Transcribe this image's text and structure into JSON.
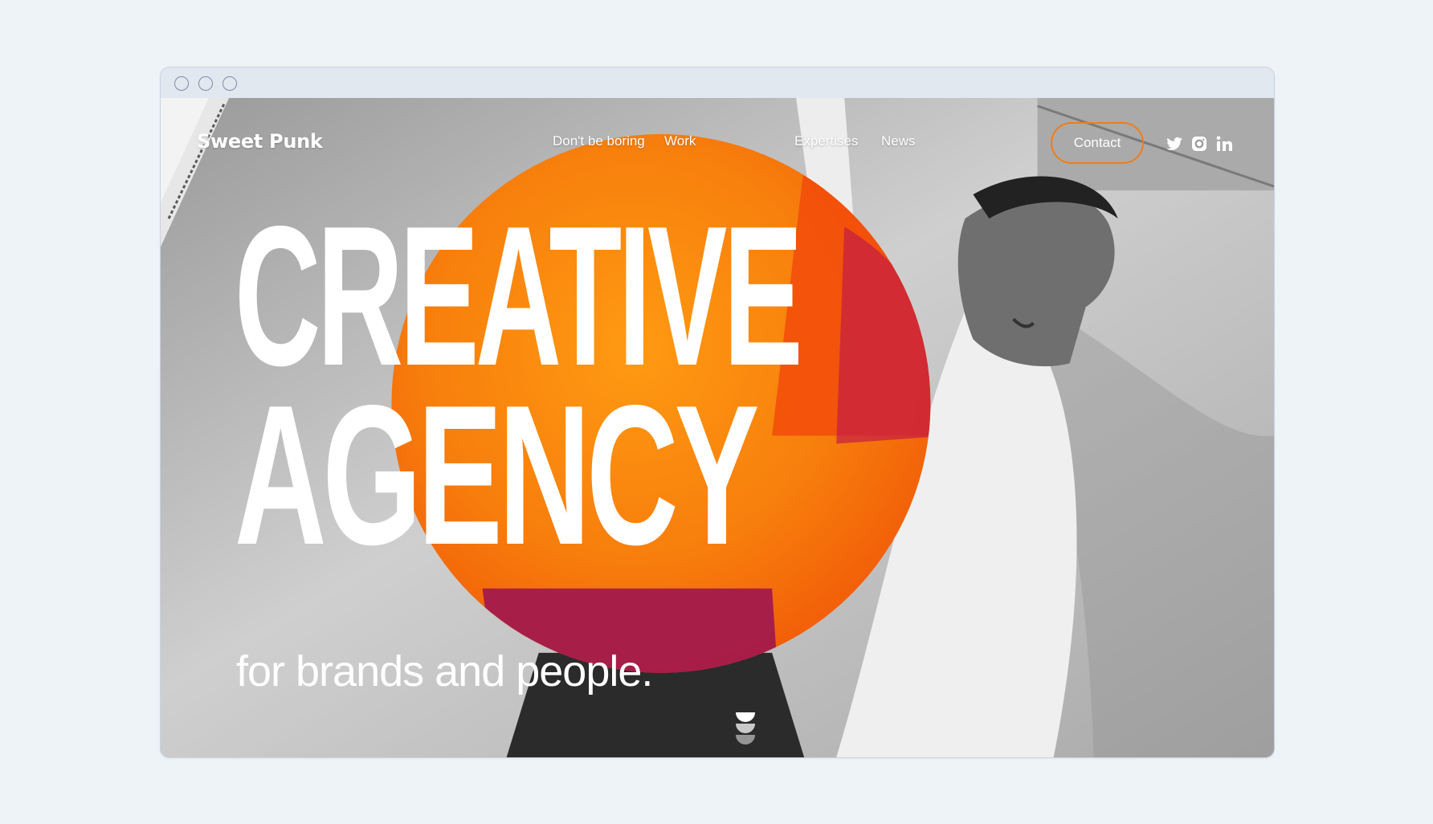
{
  "site": {
    "logo_text": "Sweet Punk",
    "nav": [
      {
        "label": "Don't be boring"
      },
      {
        "label": "Work"
      },
      {
        "label": "Expertises"
      },
      {
        "label": "News"
      }
    ],
    "contact_label": "Contact",
    "social": [
      "twitter-icon",
      "instagram-icon",
      "linkedin-icon"
    ]
  },
  "hero": {
    "headline_line1": "CREATIVE",
    "headline_line2": "AGENCY",
    "tagline": "for brands and people."
  },
  "colors": {
    "accent_orange": "#f58a10",
    "accent_red": "#f04a0a",
    "accent_magenta": "#9a1c52",
    "contact_border": "#f07c1a"
  }
}
